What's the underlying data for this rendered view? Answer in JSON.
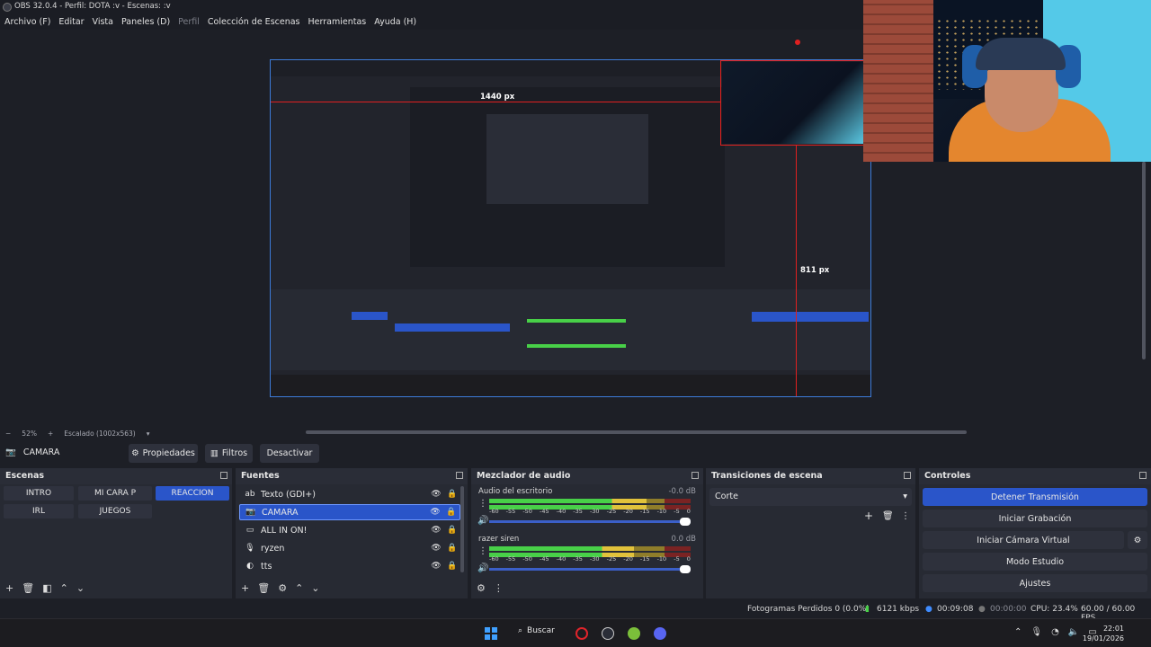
{
  "titlebar": {
    "title": "OBS 32.0.4 - Perfil: DOTA :v - Escenas: :v"
  },
  "menu": [
    "Archivo (F)",
    "Editar",
    "Vista",
    "Paneles (D)",
    "Perfil",
    "Colección de Escenas",
    "Herramientas",
    "Ayuda (H)"
  ],
  "preview": {
    "label_1440": "1440 px",
    "label_811": "811 px",
    "zoom_minus": "−",
    "zoom_level": "52%",
    "zoom_plus": "+",
    "scaling": "Escalado (1002x563)"
  },
  "source_toolbar": {
    "source_name": "CAMARA",
    "properties": "Propiedades",
    "filters": "Filtros",
    "deactivate": "Desactivar"
  },
  "scenes": {
    "title": "Escenas",
    "items": [
      "INTRO",
      "MI CARA P",
      "REACCION",
      "IRL",
      "JUEGOS"
    ],
    "active": "REACCION"
  },
  "sources": {
    "title": "Fuentes",
    "items": [
      {
        "name": "Texto (GDI+)",
        "icon": "text-icon"
      },
      {
        "name": "CAMARA",
        "icon": "camera-icon"
      },
      {
        "name": "ALL IN ON!",
        "icon": "monitor-icon"
      },
      {
        "name": "ryzen",
        "icon": "microphone-icon"
      },
      {
        "name": "tts",
        "icon": "audio-output-icon"
      }
    ]
  },
  "mixer": {
    "title": "Mezclador de audio",
    "channels": [
      {
        "name": "Audio del escritorio",
        "db": "-0.0 dB",
        "level": 0.78
      },
      {
        "name": "razer siren",
        "db": "0.0 dB",
        "level": 0.72
      }
    ],
    "scale": [
      "-60",
      "-55",
      "-50",
      "-45",
      "-40",
      "-35",
      "-30",
      "-25",
      "-20",
      "-15",
      "-10",
      "-5",
      "0"
    ]
  },
  "transitions": {
    "title": "Transiciones de escena",
    "selected": "Corte"
  },
  "controls": {
    "title": "Controles",
    "stop_stream": "Detener Transmisión",
    "start_recording": "Iniciar Grabación",
    "start_virtual_cam": "Iniciar Cámara Virtual",
    "studio_mode": "Modo Estudio",
    "settings": "Ajustes"
  },
  "status": {
    "dropped_frames": "Fotogramas Perdidos 0 (0.0%)",
    "bitrate": "6121 kbps",
    "stream_time": "00:09:08",
    "rec_time": "00:00:00",
    "cpu": "CPU: 23.4%",
    "fps": "60.00 / 60.00 FPS"
  },
  "taskbar": {
    "search": "Buscar",
    "time": "22:01",
    "date": "19/01/2026"
  },
  "colors": {
    "accent": "#2a55c9",
    "background": "#1d1f26",
    "panel": "#272a33"
  }
}
